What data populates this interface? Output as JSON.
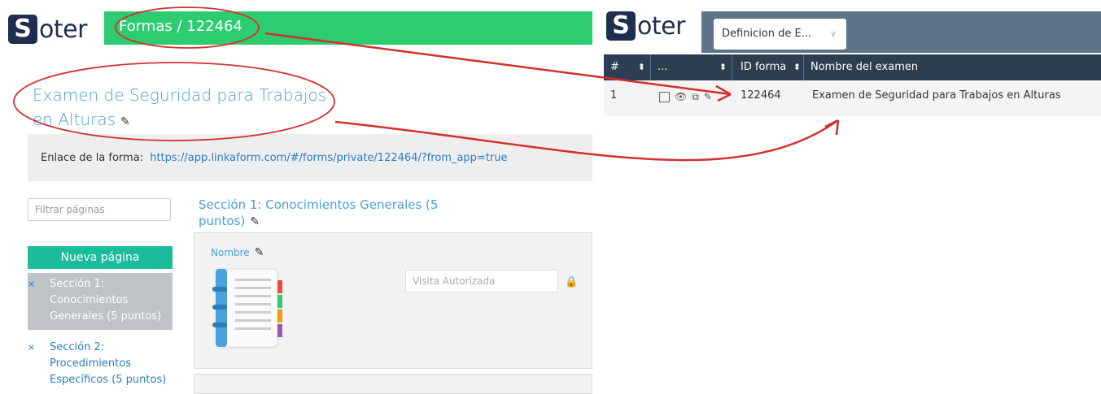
{
  "left_app": {
    "logo": {
      "s": "S",
      "rest": "oter"
    },
    "breadcrumb": "Formas / 122464",
    "form_title": "Examen de Seguridad para Trabajos en Alturas",
    "link_label": "Enlace de la forma:",
    "link_url": "https://app.linkaform.com/#/forms/private/122464/?from_app=true",
    "filter_placeholder": "Filtrar páginas",
    "new_page_button": "Nueva página",
    "pages": [
      {
        "label": "Sección 1: Conocimientos Generales (5 puntos)",
        "active": true
      },
      {
        "label": "Sección 2: Procedimientos Específicos (5 puntos)",
        "active": false
      }
    ],
    "remove_glyph": "×",
    "section_title": "Sección 1: Conocimientos Generales (5 puntos)",
    "field": {
      "label": "Nombre",
      "placeholder": "Visita Autorizada"
    }
  },
  "right_app": {
    "logo": {
      "s": "S",
      "rest": "oter"
    },
    "dropdown_value": "Definicion de E...",
    "columns": [
      "#",
      "...",
      "ID forma",
      "Nombre del examen"
    ],
    "rows": [
      {
        "num": "1",
        "id": "122464",
        "name": "Examen de Seguridad para Trabajos en Alturas"
      }
    ]
  },
  "colors": {
    "green": "#2ecc71",
    "teal": "#1abc9c",
    "navy": "#2c3e50",
    "annotation_red": "#d32f2f"
  }
}
